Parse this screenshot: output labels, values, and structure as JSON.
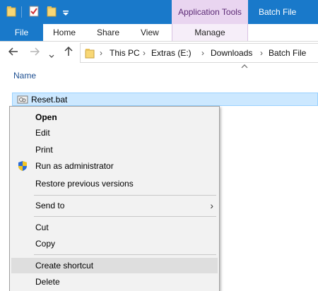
{
  "titlebar": {
    "title": "Batch File",
    "context_tab": "Application Tools",
    "quick_access": [
      "folder-icon",
      "properties-icon",
      "new-folder-icon",
      "customize-qat-icon"
    ],
    "accent_color": "#1979ca",
    "context_color": "#e9d5f0"
  },
  "ribbon": {
    "tabs": [
      {
        "label": "File"
      },
      {
        "label": "Home"
      },
      {
        "label": "Share"
      },
      {
        "label": "View"
      },
      {
        "label": "Manage"
      }
    ]
  },
  "address": {
    "nav": [
      "back-arrow-icon",
      "forward-arrow-icon",
      "dropdown-icon",
      "up-arrow-icon"
    ],
    "crumbs": [
      "This PC",
      "Extras (E:)",
      "Downloads",
      "Batch File"
    ]
  },
  "filelist": {
    "column": "Name",
    "file": "Reset.bat",
    "selected_color": "#cce8ff"
  },
  "context_menu": {
    "items": [
      {
        "label": "Open",
        "bold": true
      },
      {
        "label": "Edit"
      },
      {
        "label": "Print"
      },
      {
        "label": "Run as administrator",
        "icon": "uac-shield-icon"
      },
      {
        "label": "Restore previous versions"
      },
      {
        "label": "Send to",
        "submenu": true
      },
      {
        "label": "Cut"
      },
      {
        "label": "Copy"
      },
      {
        "label": "Create shortcut",
        "highlighted": true
      },
      {
        "label": "Delete"
      }
    ]
  }
}
